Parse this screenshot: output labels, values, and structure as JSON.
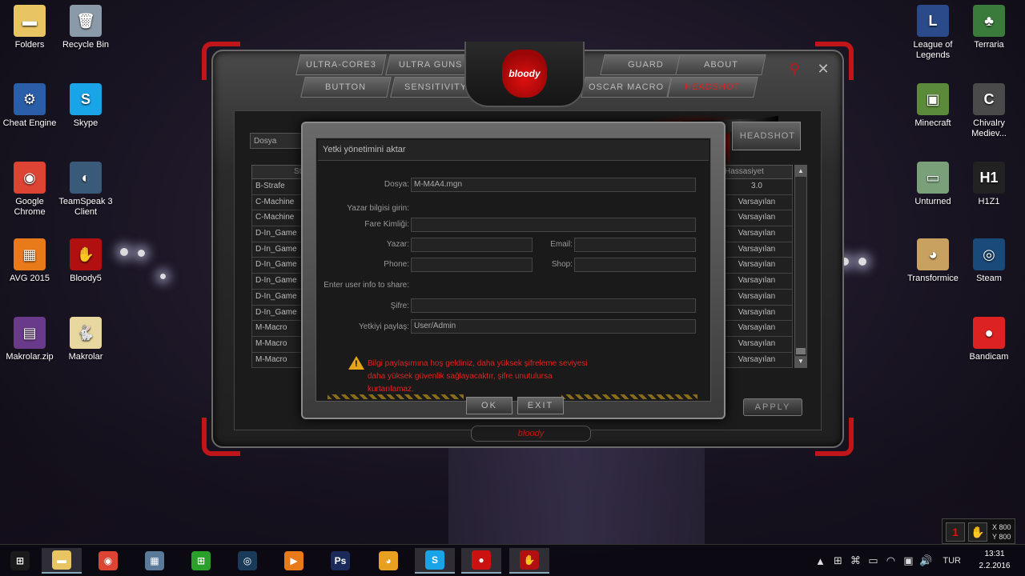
{
  "desktop_icons_left": [
    {
      "label": "Folders",
      "icon": "folder-icon",
      "color": "#e8c463",
      "glyph": "▬"
    },
    {
      "label": "Recycle Bin",
      "icon": "recycle-bin-icon",
      "color": "#8a9aa8",
      "glyph": "🗑"
    },
    {
      "label": "Cheat Engine",
      "icon": "cheat-engine-icon",
      "color": "#2a5ea8",
      "glyph": "⚙"
    },
    {
      "label": "Skype",
      "icon": "skype-icon",
      "color": "#1aa4e8",
      "glyph": "S"
    },
    {
      "label": "Google Chrome",
      "icon": "chrome-icon",
      "color": "#dd4433",
      "glyph": "◉"
    },
    {
      "label": "TeamSpeak 3 Client",
      "icon": "teamspeak-icon",
      "color": "#3a5a7a",
      "glyph": "◐"
    },
    {
      "label": "AVG 2015",
      "icon": "avg-icon",
      "color": "#e87a1a",
      "glyph": "▦"
    },
    {
      "label": "Bloody5",
      "icon": "bloody-icon",
      "color": "#b01010",
      "glyph": "✋"
    },
    {
      "label": "Makrolar.zip",
      "icon": "winrar-icon",
      "color": "#6a3a8a",
      "glyph": "▤"
    },
    {
      "label": "Makrolar",
      "icon": "folder-icon",
      "color": "#e8d8a0",
      "glyph": "🐇"
    }
  ],
  "desktop_icons_right": [
    {
      "label": "League of Legends",
      "icon": "league-icon",
      "color": "#2a4a8a",
      "glyph": "L"
    },
    {
      "label": "Terraria",
      "icon": "terraria-icon",
      "color": "#3a7a3a",
      "glyph": "♣"
    },
    {
      "label": "Minecraft",
      "icon": "minecraft-icon",
      "color": "#5a8a3a",
      "glyph": "▣"
    },
    {
      "label": "Chivalry Mediev...",
      "icon": "chivalry-icon",
      "color": "#4a4a4a",
      "glyph": "C"
    },
    {
      "label": "Unturned",
      "icon": "unturned-icon",
      "color": "#7aa07a",
      "glyph": "▭"
    },
    {
      "label": "H1Z1",
      "icon": "h1z1-icon",
      "color": "#222222",
      "glyph": "H1"
    },
    {
      "label": "Transformice",
      "icon": "transformice-icon",
      "color": "#c8a060",
      "glyph": "◕"
    },
    {
      "label": "Steam",
      "icon": "steam-icon",
      "color": "#1a4a7a",
      "glyph": "◎"
    },
    {
      "label": "Bandicam",
      "icon": "bandicam-icon",
      "color": "#dd2222",
      "glyph": "●"
    }
  ],
  "bloody": {
    "tabs_top": [
      "Ultra-Core3",
      "Ultra Guns",
      "Guard",
      "About"
    ],
    "tabs_bottom": [
      "Button",
      "Sensitivity",
      "Oscar Macro",
      "Headshot"
    ],
    "active_tab": "Headshot",
    "logo_text": "bloody",
    "dosya_label": "Dosya",
    "headshot_button": "Headshot",
    "left_header": "Stil",
    "left_rows": [
      "B-Strafe",
      "C-Machine",
      "C-Machine",
      "D-In_Game",
      "D-In_Game",
      "D-In_Game",
      "D-In_Game",
      "D-In_Game",
      "D-In_Game",
      "M-Macro",
      "M-Macro",
      "M-Macro"
    ],
    "right_header": "Hassasiyet",
    "right_rows": [
      "3.0",
      "Varsayılan",
      "Varsayılan",
      "Varsayılan",
      "Varsayılan",
      "Varsayılan",
      "Varsayılan",
      "Varsayılan",
      "Varsayılan",
      "Varsayılan",
      "Varsayılan",
      "Varsayılan"
    ],
    "apply_label": "APPLY",
    "bottom_brand": "bloody"
  },
  "dialog": {
    "title": "Yetki yönetimini aktar",
    "dosya_label": "Dosya:",
    "dosya_value": "M-M4A4.mgn",
    "yazar_bilgisi_label": "Yazar bilgisi girin:",
    "fare_label": "Fare Kimliği:",
    "yazar_label": "Yazar:",
    "email_label": "Email:",
    "phone_label": "Phone:",
    "shop_label": "Shop:",
    "share_label": "Enter user info to share:",
    "sifre_label": "Şifre:",
    "paylas_label": "Yetkiyi paylaş:",
    "paylas_value": "User/Admin",
    "warning": "Bilgi paylaşımına hoş geldiniz, daha yüksek şifreleme seviyesi daha yüksek güvenlik sağlayacaktır, şifre unutulursa kurtarılamaz.",
    "ok_label": "OK",
    "exit_label": "EXIT"
  },
  "taskbar": {
    "apps": [
      {
        "name": "start-button",
        "glyph": "⊞",
        "color": "#1a1a1a"
      },
      {
        "name": "file-explorer-icon",
        "glyph": "▬",
        "color": "#e8c463"
      },
      {
        "name": "chrome-icon",
        "glyph": "◉",
        "color": "#dd4433"
      },
      {
        "name": "calculator-icon",
        "glyph": "▦",
        "color": "#5a7a9a"
      },
      {
        "name": "store-icon",
        "glyph": "⊞",
        "color": "#2aa02a"
      },
      {
        "name": "steam-icon",
        "glyph": "◎",
        "color": "#1a3a5a"
      },
      {
        "name": "media-player-icon",
        "glyph": "▶",
        "color": "#e87a1a"
      },
      {
        "name": "photoshop-icon",
        "glyph": "Ps",
        "color": "#1a2a5a"
      },
      {
        "name": "transformice-icon",
        "glyph": "◕",
        "color": "#e8a020"
      },
      {
        "name": "skype-icon",
        "glyph": "S",
        "color": "#1aa4e8"
      },
      {
        "name": "bandicam-icon",
        "glyph": "●",
        "color": "#cc1111"
      },
      {
        "name": "bloody-icon",
        "glyph": "✋",
        "color": "#b01010"
      }
    ],
    "language": "TUR",
    "time": "13:31",
    "date": "2.2.2016"
  },
  "mini_widget": {
    "x_label": "X 800",
    "y_label": "Y 800"
  }
}
